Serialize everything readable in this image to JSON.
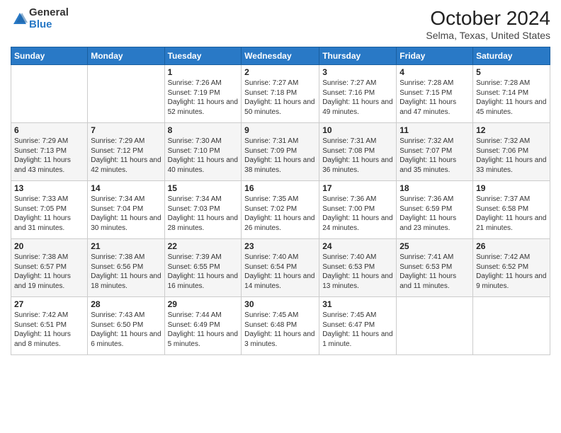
{
  "header": {
    "logo_general": "General",
    "logo_blue": "Blue",
    "title": "October 2024",
    "location": "Selma, Texas, United States"
  },
  "days_of_week": [
    "Sunday",
    "Monday",
    "Tuesday",
    "Wednesday",
    "Thursday",
    "Friday",
    "Saturday"
  ],
  "weeks": [
    [
      {
        "day": "",
        "info": ""
      },
      {
        "day": "",
        "info": ""
      },
      {
        "day": "1",
        "info": "Sunrise: 7:26 AM\nSunset: 7:19 PM\nDaylight: 11 hours and 52 minutes."
      },
      {
        "day": "2",
        "info": "Sunrise: 7:27 AM\nSunset: 7:18 PM\nDaylight: 11 hours and 50 minutes."
      },
      {
        "day": "3",
        "info": "Sunrise: 7:27 AM\nSunset: 7:16 PM\nDaylight: 11 hours and 49 minutes."
      },
      {
        "day": "4",
        "info": "Sunrise: 7:28 AM\nSunset: 7:15 PM\nDaylight: 11 hours and 47 minutes."
      },
      {
        "day": "5",
        "info": "Sunrise: 7:28 AM\nSunset: 7:14 PM\nDaylight: 11 hours and 45 minutes."
      }
    ],
    [
      {
        "day": "6",
        "info": "Sunrise: 7:29 AM\nSunset: 7:13 PM\nDaylight: 11 hours and 43 minutes."
      },
      {
        "day": "7",
        "info": "Sunrise: 7:29 AM\nSunset: 7:12 PM\nDaylight: 11 hours and 42 minutes."
      },
      {
        "day": "8",
        "info": "Sunrise: 7:30 AM\nSunset: 7:10 PM\nDaylight: 11 hours and 40 minutes."
      },
      {
        "day": "9",
        "info": "Sunrise: 7:31 AM\nSunset: 7:09 PM\nDaylight: 11 hours and 38 minutes."
      },
      {
        "day": "10",
        "info": "Sunrise: 7:31 AM\nSunset: 7:08 PM\nDaylight: 11 hours and 36 minutes."
      },
      {
        "day": "11",
        "info": "Sunrise: 7:32 AM\nSunset: 7:07 PM\nDaylight: 11 hours and 35 minutes."
      },
      {
        "day": "12",
        "info": "Sunrise: 7:32 AM\nSunset: 7:06 PM\nDaylight: 11 hours and 33 minutes."
      }
    ],
    [
      {
        "day": "13",
        "info": "Sunrise: 7:33 AM\nSunset: 7:05 PM\nDaylight: 11 hours and 31 minutes."
      },
      {
        "day": "14",
        "info": "Sunrise: 7:34 AM\nSunset: 7:04 PM\nDaylight: 11 hours and 30 minutes."
      },
      {
        "day": "15",
        "info": "Sunrise: 7:34 AM\nSunset: 7:03 PM\nDaylight: 11 hours and 28 minutes."
      },
      {
        "day": "16",
        "info": "Sunrise: 7:35 AM\nSunset: 7:02 PM\nDaylight: 11 hours and 26 minutes."
      },
      {
        "day": "17",
        "info": "Sunrise: 7:36 AM\nSunset: 7:00 PM\nDaylight: 11 hours and 24 minutes."
      },
      {
        "day": "18",
        "info": "Sunrise: 7:36 AM\nSunset: 6:59 PM\nDaylight: 11 hours and 23 minutes."
      },
      {
        "day": "19",
        "info": "Sunrise: 7:37 AM\nSunset: 6:58 PM\nDaylight: 11 hours and 21 minutes."
      }
    ],
    [
      {
        "day": "20",
        "info": "Sunrise: 7:38 AM\nSunset: 6:57 PM\nDaylight: 11 hours and 19 minutes."
      },
      {
        "day": "21",
        "info": "Sunrise: 7:38 AM\nSunset: 6:56 PM\nDaylight: 11 hours and 18 minutes."
      },
      {
        "day": "22",
        "info": "Sunrise: 7:39 AM\nSunset: 6:55 PM\nDaylight: 11 hours and 16 minutes."
      },
      {
        "day": "23",
        "info": "Sunrise: 7:40 AM\nSunset: 6:54 PM\nDaylight: 11 hours and 14 minutes."
      },
      {
        "day": "24",
        "info": "Sunrise: 7:40 AM\nSunset: 6:53 PM\nDaylight: 11 hours and 13 minutes."
      },
      {
        "day": "25",
        "info": "Sunrise: 7:41 AM\nSunset: 6:53 PM\nDaylight: 11 hours and 11 minutes."
      },
      {
        "day": "26",
        "info": "Sunrise: 7:42 AM\nSunset: 6:52 PM\nDaylight: 11 hours and 9 minutes."
      }
    ],
    [
      {
        "day": "27",
        "info": "Sunrise: 7:42 AM\nSunset: 6:51 PM\nDaylight: 11 hours and 8 minutes."
      },
      {
        "day": "28",
        "info": "Sunrise: 7:43 AM\nSunset: 6:50 PM\nDaylight: 11 hours and 6 minutes."
      },
      {
        "day": "29",
        "info": "Sunrise: 7:44 AM\nSunset: 6:49 PM\nDaylight: 11 hours and 5 minutes."
      },
      {
        "day": "30",
        "info": "Sunrise: 7:45 AM\nSunset: 6:48 PM\nDaylight: 11 hours and 3 minutes."
      },
      {
        "day": "31",
        "info": "Sunrise: 7:45 AM\nSunset: 6:47 PM\nDaylight: 11 hours and 1 minute."
      },
      {
        "day": "",
        "info": ""
      },
      {
        "day": "",
        "info": ""
      }
    ]
  ]
}
